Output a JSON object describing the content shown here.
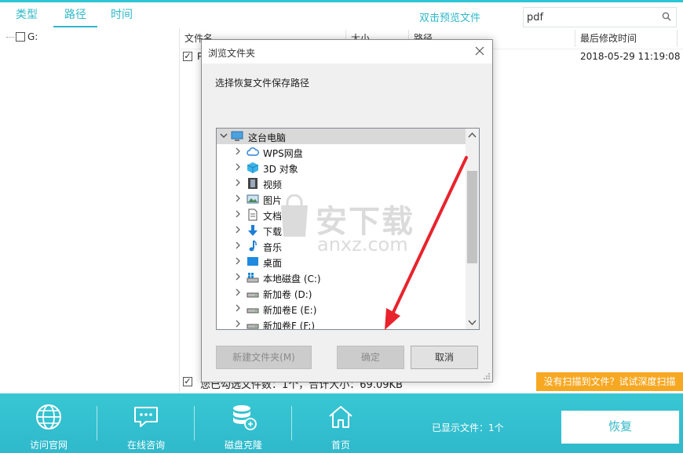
{
  "tabs": [
    {
      "label": "类型"
    },
    {
      "label": "路径"
    },
    {
      "label": "时间"
    }
  ],
  "preview_link": "双击预览文件",
  "search": {
    "value": "pdf"
  },
  "tree": {
    "drive": "G:"
  },
  "table": {
    "columns": [
      "文件名",
      "大小",
      "路径",
      "最后修改时间"
    ],
    "rows": [
      {
        "name": "P",
        "modified": "2018-05-29 11:19:08"
      }
    ]
  },
  "stats": "您已勾选文件数：1个，合计大小：69.09KB",
  "deep_scan": "没有扫描到文件？试试深度扫描",
  "bottom_nav": [
    {
      "label": "访问官网",
      "icon": "globe-icon"
    },
    {
      "label": "在线咨询",
      "icon": "chat-icon"
    },
    {
      "label": "磁盘克隆",
      "icon": "database-icon"
    },
    {
      "label": "首页",
      "icon": "home-icon"
    }
  ],
  "shown_count": "已显示文件：1个",
  "recover_label": "恢复",
  "dialog": {
    "title": "浏览文件夹",
    "prompt": "选择恢复文件保存路径",
    "tree": [
      {
        "label": "这台电脑",
        "icon": "computer-icon"
      },
      {
        "label": "WPS网盘",
        "icon": "cloud-icon"
      },
      {
        "label": "3D 对象",
        "icon": "cube-icon"
      },
      {
        "label": "视频",
        "icon": "video-icon"
      },
      {
        "label": "图片",
        "icon": "picture-icon"
      },
      {
        "label": "文档",
        "icon": "document-icon"
      },
      {
        "label": "下载",
        "icon": "download-icon"
      },
      {
        "label": "音乐",
        "icon": "music-icon"
      },
      {
        "label": "桌面",
        "icon": "desktop-icon"
      },
      {
        "label": "本地磁盘 (C:)",
        "icon": "system-drive-icon"
      },
      {
        "label": "新加卷 (D:)",
        "icon": "drive-icon"
      },
      {
        "label": "新加卷E (E:)",
        "icon": "drive-icon"
      },
      {
        "label": "新加卷F (F:)",
        "icon": "drive-icon"
      }
    ],
    "buttons": {
      "new_folder": "新建文件夹(M)",
      "ok": "确定",
      "cancel": "取消"
    }
  },
  "watermark": {
    "text": "安下载",
    "sub": "anxz.com"
  },
  "colors": {
    "accent": "#2fb8c9",
    "deep_scan": "#f7a823",
    "arrow": "#e8232d"
  }
}
